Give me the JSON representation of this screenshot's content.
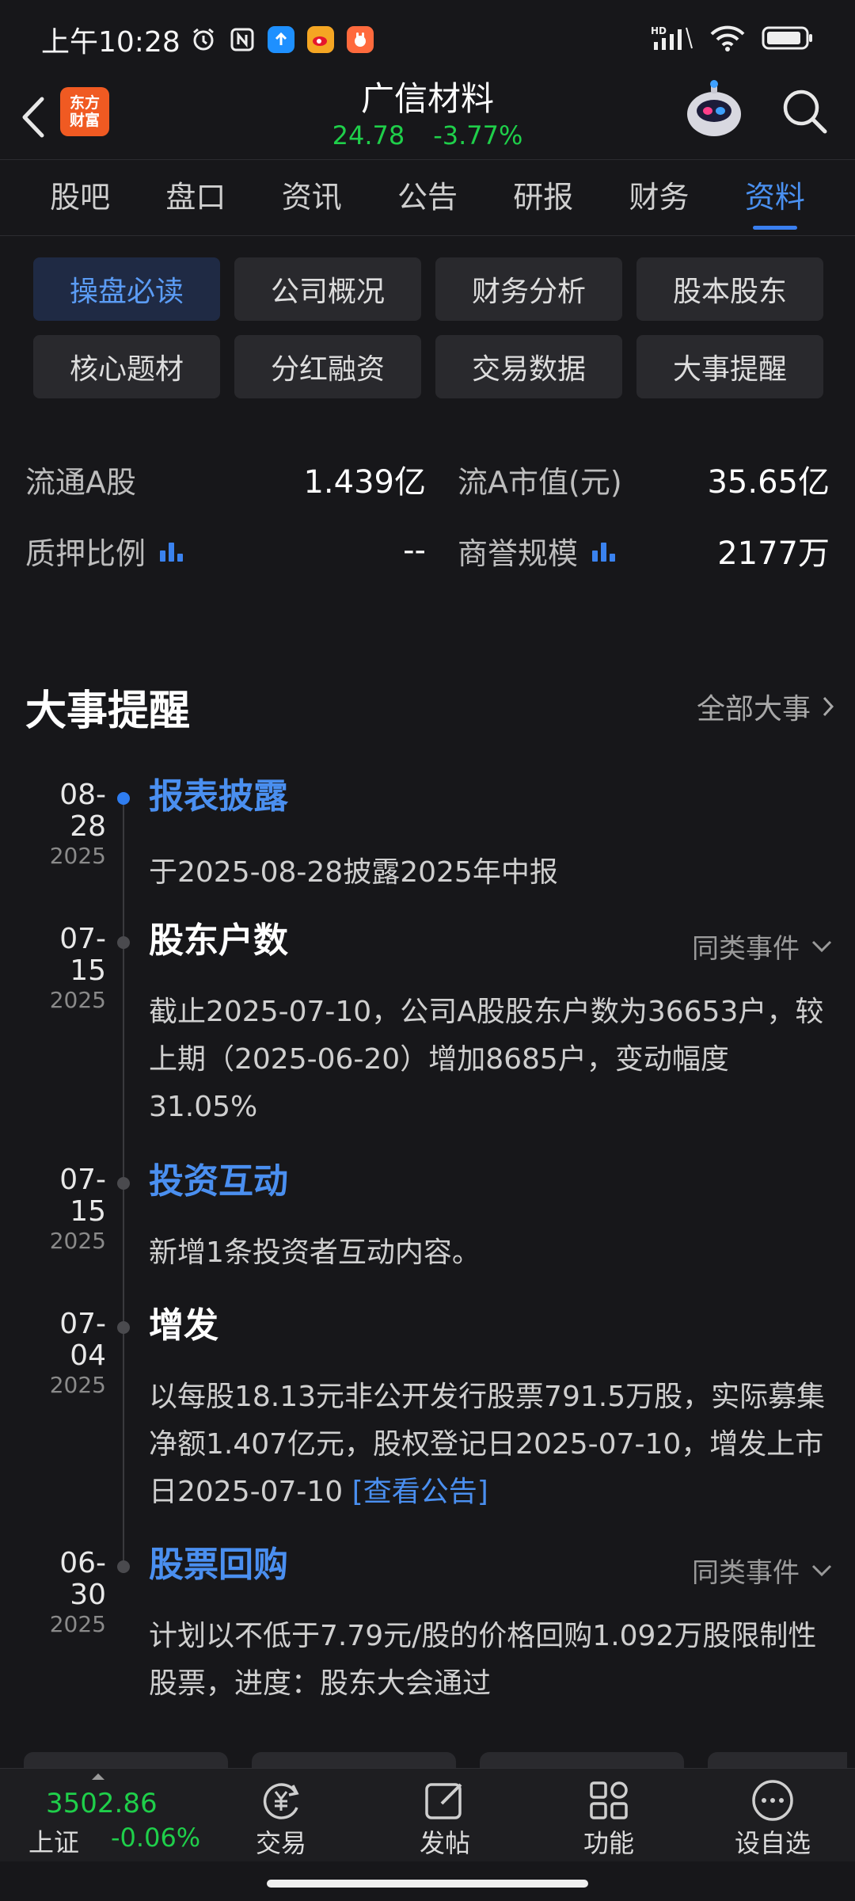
{
  "status_bar": {
    "time": "上午10:28",
    "network": "HD",
    "battery_level": 0.8
  },
  "header": {
    "logo_line1": "东方",
    "logo_line2": "财富",
    "stock_name": "广信材料",
    "price": "24.78",
    "change_pct": "-3.77%"
  },
  "tabs": [
    {
      "label": "股吧"
    },
    {
      "label": "盘口"
    },
    {
      "label": "资讯"
    },
    {
      "label": "公告"
    },
    {
      "label": "研报"
    },
    {
      "label": "财务"
    },
    {
      "label": "资料",
      "active": true
    }
  ],
  "sub_buttons": [
    {
      "label": "操盘必读",
      "active": true
    },
    {
      "label": "公司概况"
    },
    {
      "label": "财务分析"
    },
    {
      "label": "股本股东"
    },
    {
      "label": "核心题材"
    },
    {
      "label": "分红融资"
    },
    {
      "label": "交易数据"
    },
    {
      "label": "大事提醒"
    }
  ],
  "metrics": {
    "float_a_label": "流通A股",
    "float_a_value": "1.439亿",
    "float_mv_label": "流A市值(元)",
    "float_mv_value": "35.65亿",
    "pledge_label": "质押比例",
    "pledge_value": "--",
    "goodwill_label": "商誉规模",
    "goodwill_value": "2177万"
  },
  "events_section": {
    "title": "大事提醒",
    "all_link": "全部大事",
    "similar_label": "同类事件",
    "events": [
      {
        "date": "08-28",
        "year": "2025",
        "title": "报表披露",
        "desc": "于2025-08-28披露2025年中报"
      },
      {
        "date": "07-15",
        "year": "2025",
        "title": "股东户数",
        "desc": "截止2025-07-10，公司A股股东户数为36653户，较上期（2025-06-20）增加8685户，变动幅度31.05%"
      },
      {
        "date": "07-15",
        "year": "2025",
        "title": "投资互动",
        "desc": "新增1条投资者互动内容。"
      },
      {
        "date": "07-04",
        "year": "2025",
        "title": "增发",
        "desc": "以每股18.13元非公开发行股票791.5万股，实际募集净额1.407亿元，股权登记日2025-07-10，增发上市日2025-07-10",
        "link": "[查看公告]"
      },
      {
        "date": "06-30",
        "year": "2025",
        "title": "股票回购",
        "desc": "计划以不低于7.79元/股的价格回购1.092万股限制性股票，进度：股东大会通过"
      }
    ]
  },
  "bottom_nav": {
    "index_value": "3502.86",
    "index_name": "上证",
    "index_change": "-0.06%",
    "items": [
      {
        "label": "交易"
      },
      {
        "label": "发帖"
      },
      {
        "label": "功能"
      },
      {
        "label": "设自选"
      }
    ]
  },
  "colors": {
    "background": "#17171a",
    "accent_blue": "#4a8ff0",
    "down_green": "#1fcf4a"
  }
}
